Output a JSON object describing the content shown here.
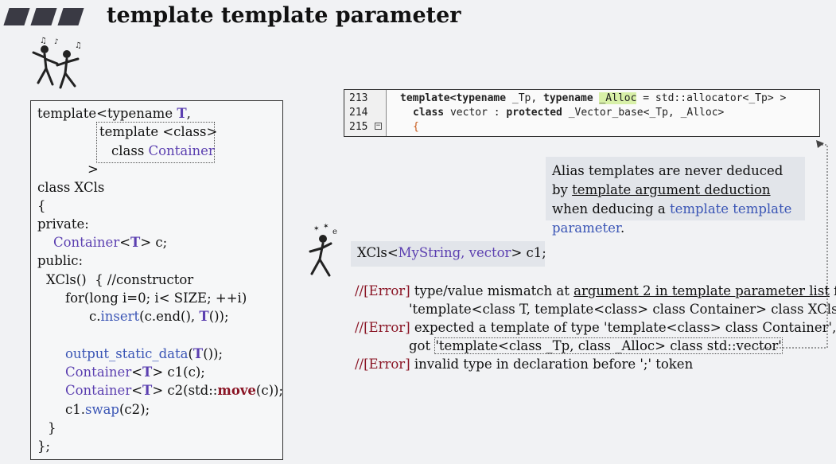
{
  "title": "template template parameter",
  "code_box": {
    "lines": [
      "template<typename ",
      "T",
      ",",
      "template <class>",
      "class ",
      "Container",
      ">",
      "class XCls",
      "{",
      "private:",
      "Container",
      "<",
      "T",
      "> c;",
      "public:",
      "XCls()  { //constructor",
      "for(long i=0; i< SIZE; ++i)",
      "c.",
      "insert",
      "(c.end(), ",
      "T",
      "());",
      "output_static_data",
      "(",
      "T",
      "());",
      "Container",
      "<",
      "T",
      "> c1(c);",
      "Container",
      "<",
      "T",
      "> c2(std::",
      "move",
      "(c));",
      "c1.",
      "swap",
      "(c2);",
      "}",
      "};"
    ]
  },
  "stl_source": {
    "line_numbers": [
      "213",
      "214",
      "215"
    ],
    "line213": [
      "template<typename",
      " _Tp, ",
      "typename",
      " ",
      "_Alloc",
      " = std::allocator<_Tp> >"
    ],
    "line214": [
      "class",
      " vector : ",
      "protected",
      " _Vector_base<_Tp, _Alloc>"
    ],
    "line215": "{",
    "fold": "−"
  },
  "note": {
    "part1": "Alias templates are never deduced by ",
    "part2": "template argument deduction",
    "part3": " when deducing a ",
    "part4": "template template parameter",
    "part5": "."
  },
  "usage": {
    "p1": "XCls<",
    "p2": "MyString, vector",
    "p3": ">  c1;"
  },
  "errors": {
    "tag": "//[Error]",
    "e1a": " type/value mismatch at ",
    "e1b": "argument 2 in template parameter list",
    "e1c": " for",
    "e1d": "'template<class T, template<class> class Container> class XCls'",
    "e2a": " expected a template of type 'template<class> class Container',",
    "e2b": "got ",
    "e2c": "'template<class _Tp, class _Alloc> class std::vector'",
    "e3": " invalid type in declaration before ';' token"
  },
  "colors": {
    "background": "#f1f2f4",
    "purple": "#5b3fb0",
    "blue": "#3a55b5",
    "maroon": "#8a1525",
    "highlight": "#d8f0a8"
  }
}
